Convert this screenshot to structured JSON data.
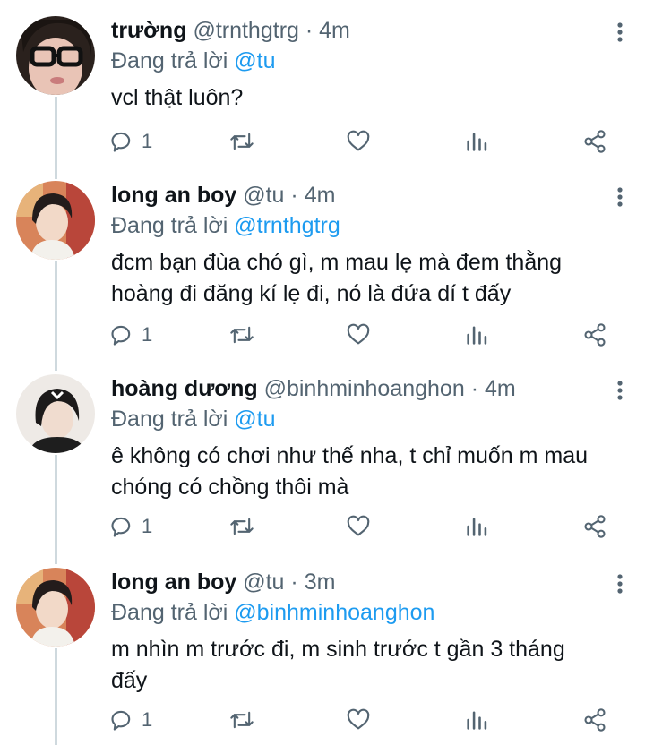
{
  "tweets": [
    {
      "name": "trường",
      "handle": "@trnthgtrg",
      "time": "· 4m",
      "reply_prefix": "Đang trả lời ",
      "reply_to": "@tu",
      "text_lines": [
        "vcl thật luôn?"
      ],
      "reply_count": "1"
    },
    {
      "name": "long an boy",
      "handle": "@tu",
      "time": "· 4m",
      "reply_prefix": "Đang trả lời ",
      "reply_to": "@trnthgtrg",
      "text_lines": [
        "đcm bạn đùa chó gì, m mau lẹ mà đem thằng",
        "hoàng đi đăng kí lẹ đi, nó là đứa dí t đấy"
      ],
      "reply_count": "1"
    },
    {
      "name": "hoàng dương",
      "handle": "@binhminhoanghon",
      "time": "· 4m",
      "reply_prefix": "Đang trả lời ",
      "reply_to": "@tu",
      "text_lines": [
        "ê không có chơi như thế nha, t chỉ muốn m mau",
        "chóng có chồng thôi mà"
      ],
      "reply_count": "1"
    },
    {
      "name": "long an boy",
      "handle": "@tu",
      "time": "· 3m",
      "reply_prefix": "Đang trả lời ",
      "reply_to": "@binhminhoanghon",
      "text_lines": [
        "m nhìn m trước đi, m sinh trước t gần 3 tháng",
        "đấy"
      ],
      "reply_count": "1"
    }
  ],
  "icons": {
    "reply": "reply-icon",
    "retweet": "retweet-icon",
    "like": "heart-icon",
    "views": "views-icon",
    "share": "share-icon",
    "more": "more-icon"
  },
  "colors": {
    "text": "#0f1419",
    "muted": "#536471",
    "accent": "#1d9bf0",
    "thread_line": "#cfd9de"
  }
}
